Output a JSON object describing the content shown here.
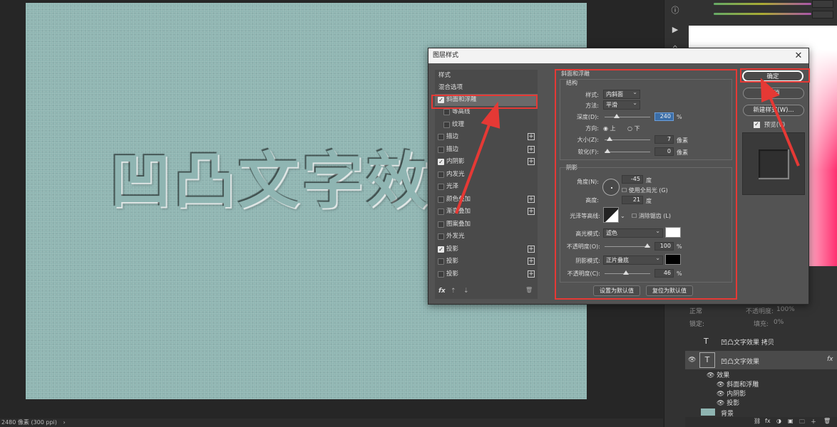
{
  "canvas": {
    "headline_text": "凹凸文字效",
    "status_text": "2480 像素 (300 ppi)",
    "status_arrow": "›"
  },
  "dialog": {
    "title": "图层样式",
    "close_glyph": "✕",
    "style_list": {
      "items": [
        {
          "label": "样式",
          "checkbox": false,
          "checked": false,
          "plus": false,
          "indent": false
        },
        {
          "label": "混合选项",
          "checkbox": false,
          "checked": false,
          "plus": false,
          "indent": false
        },
        {
          "label": "斜面和浮雕",
          "checkbox": true,
          "checked": true,
          "plus": false,
          "indent": false,
          "selected": true
        },
        {
          "label": "等高线",
          "checkbox": true,
          "checked": false,
          "plus": false,
          "indent": true
        },
        {
          "label": "纹理",
          "checkbox": true,
          "checked": false,
          "plus": false,
          "indent": true
        },
        {
          "label": "描边",
          "checkbox": true,
          "checked": false,
          "plus": true,
          "indent": false
        },
        {
          "label": "描边",
          "checkbox": true,
          "checked": false,
          "plus": true,
          "indent": false
        },
        {
          "label": "内阴影",
          "checkbox": true,
          "checked": true,
          "plus": true,
          "indent": false
        },
        {
          "label": "内发光",
          "checkbox": true,
          "checked": false,
          "plus": false,
          "indent": false
        },
        {
          "label": "光泽",
          "checkbox": true,
          "checked": false,
          "plus": false,
          "indent": false
        },
        {
          "label": "颜色叠加",
          "checkbox": true,
          "checked": false,
          "plus": true,
          "indent": false
        },
        {
          "label": "渐变叠加",
          "checkbox": true,
          "checked": false,
          "plus": true,
          "indent": false
        },
        {
          "label": "图案叠加",
          "checkbox": true,
          "checked": false,
          "plus": false,
          "indent": false
        },
        {
          "label": "外发光",
          "checkbox": true,
          "checked": false,
          "plus": false,
          "indent": false
        },
        {
          "label": "投影",
          "checkbox": true,
          "checked": true,
          "plus": true,
          "indent": false
        },
        {
          "label": "投影",
          "checkbox": true,
          "checked": false,
          "plus": true,
          "indent": false
        },
        {
          "label": "投影",
          "checkbox": true,
          "checked": false,
          "plus": true,
          "indent": false
        }
      ],
      "footer_fx": "fx",
      "footer_up": "⇡",
      "footer_down": "⇣",
      "footer_trash": "🗑"
    },
    "bevel": {
      "header": "斜面和浮雕",
      "structure_title": "结构",
      "style_label": "样式:",
      "style_value": "内斜面",
      "method_label": "方法:",
      "method_value": "平滑",
      "depth_label": "深度(D):",
      "depth_value": "240",
      "depth_unit": "%",
      "depth_fraction": 0.24,
      "direction_label": "方向:",
      "direction_up": "上",
      "direction_down": "下",
      "size_label": "大小(Z):",
      "size_value": "7",
      "size_unit": "像素",
      "size_fraction": 0.05,
      "soften_label": "软化(F):",
      "soften_value": "0",
      "soften_unit": "像素",
      "soften_fraction": 0.0,
      "shading_title": "阴影",
      "angle_label": "角度(N):",
      "angle_value": "-45",
      "angle_unit": "度",
      "global_light_label": "使用全局光 (G)",
      "altitude_label": "高度:",
      "altitude_value": "21",
      "altitude_unit": "度",
      "gloss_label": "光泽等高线:",
      "antialias_label": "消除锯齿 (L)",
      "highlight_mode_label": "高光模式:",
      "highlight_mode_value": "滤色",
      "highlight_color": "#ffffff",
      "highlight_opacity_label": "不透明度(O):",
      "highlight_opacity_value": "100",
      "highlight_opacity_unit": "%",
      "highlight_opacity_fraction": 1.0,
      "shadow_mode_label": "阴影模式:",
      "shadow_mode_value": "正片叠底",
      "shadow_color": "#000000",
      "shadow_opacity_label": "不透明度(C):",
      "shadow_opacity_value": "46",
      "shadow_opacity_unit": "%",
      "shadow_opacity_fraction": 0.46,
      "set_default_label": "设置为默认值",
      "reset_default_label": "复位为默认值"
    },
    "buttons": {
      "ok": "确定",
      "cancel": "取消",
      "new_style": "新建样式(W)...",
      "preview": "预览(V)"
    }
  },
  "layers": {
    "blend_mode": "正常",
    "opacity_label": "不透明度:",
    "opacity_value": "100%",
    "lock_label": "锁定:",
    "fill_label": "填充:",
    "fill_value": "0%",
    "rows": [
      {
        "name": "凹凸文字效果 拷贝",
        "kind": "T"
      },
      {
        "name": "凹凸文字效果",
        "kind": "T",
        "fx": "fx"
      }
    ],
    "effects_label": "效果",
    "effects": [
      "斜面和浮雕",
      "内阴影",
      "投影"
    ],
    "bottom_layer": "背景",
    "footer_icons": [
      "⛓",
      "fx",
      "◑",
      "▣",
      "🗀",
      "＋",
      "🗑"
    ]
  },
  "colors": {
    "highlight_red": "#e53935",
    "canvas_bg": "#8fb5b2"
  }
}
